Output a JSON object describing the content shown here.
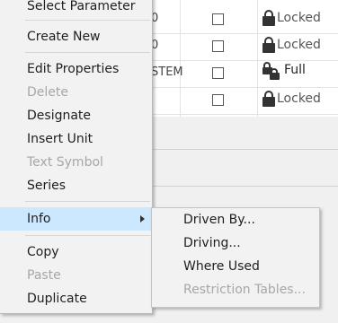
{
  "grid": {
    "rows": [
      {
        "stub": "0",
        "status": "Locked",
        "checked": false
      },
      {
        "stub": "0",
        "status": "Locked",
        "checked": false
      },
      {
        "stub": "STEM",
        "status": "Full",
        "checked": false
      },
      {
        "stub": "",
        "status": "Locked",
        "checked": false
      }
    ]
  },
  "context_menu": {
    "items": [
      {
        "label": "Select Parameter",
        "enabled": true
      },
      {
        "label": "Create New",
        "enabled": true
      },
      {
        "label": "Edit Properties",
        "enabled": true
      },
      {
        "label": "Delete",
        "enabled": false
      },
      {
        "label": "Designate",
        "enabled": true
      },
      {
        "label": "Insert Unit",
        "enabled": true
      },
      {
        "label": "Text Symbol",
        "enabled": false
      },
      {
        "label": "Series",
        "enabled": true
      },
      {
        "label": "Info",
        "enabled": true,
        "has_submenu": true,
        "highlighted": true
      },
      {
        "label": "Copy",
        "enabled": true
      },
      {
        "label": "Paste",
        "enabled": false
      },
      {
        "label": "Duplicate",
        "enabled": true
      }
    ]
  },
  "info_submenu": {
    "items": [
      {
        "label": "Driven By...",
        "enabled": true
      },
      {
        "label": "Driving...",
        "enabled": true
      },
      {
        "label": "Where Used",
        "enabled": true
      },
      {
        "label": "Restriction Tables...",
        "enabled": false
      }
    ]
  },
  "colors": {
    "menu_background": "#f2f2f2",
    "highlight": "#cce8ff",
    "disabled_text": "#a7a7a7"
  }
}
